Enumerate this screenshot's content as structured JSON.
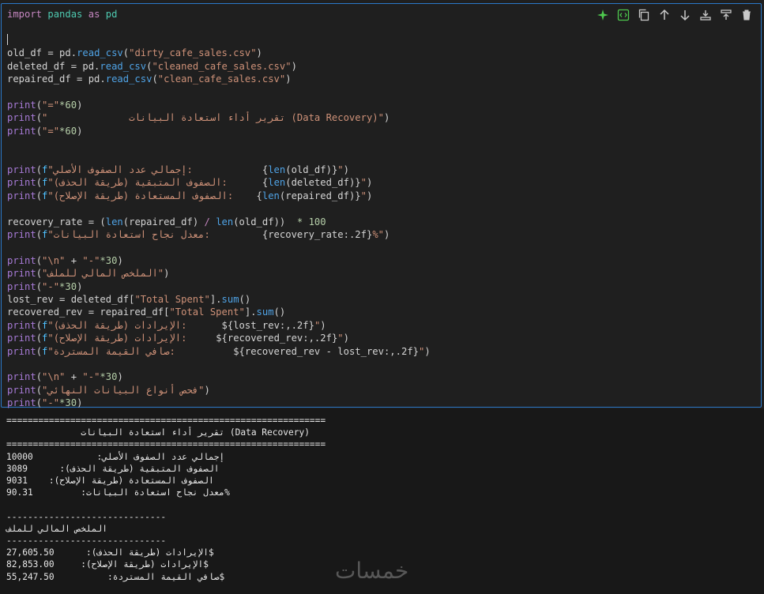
{
  "toolbar": {
    "icons": [
      "sparkle-icon",
      "code-icon",
      "copy-icon",
      "arrow-up-icon",
      "arrow-down-icon",
      "insert-below-icon",
      "insert-above-icon",
      "trash-icon"
    ]
  },
  "code": {
    "l1_import": "import",
    "l1_pandas": " pandas ",
    "l1_as": "as",
    "l1_pd": " pd",
    "l3_a": "old_df = pd.",
    "read_csv": "read_csv",
    "l3_s": "\"dirty_cafe_sales.csv\"",
    "l4_a": "deleted_df = pd.",
    "l4_s": "\"cleaned_cafe_sales.csv\"",
    "l5_a": "repaired_df = pd.",
    "l5_s": "\"clean_cafe_sales.csv\"",
    "print": "print",
    "eq_str": "\"=\"",
    "star60": "*60",
    "title_str": "\"              تقرير أداء استعادة البيانات (Data Recovery)\"",
    "f": "f",
    "l11_s": "\"إجمالي عدد الصفوف الأصلي:            ",
    "len": "len",
    "l11_v": "old_df",
    "l12_s": "\"الصفوف المتبقية (طريقة الحذف):      ",
    "l12_v": "deleted_df",
    "l13_s": "\"الصفوف المستعادة (طريقة الإصلاح):    ",
    "l13_v": "repaired_df",
    "l15_a": "recovery_rate = (",
    "l15_b": " * 100",
    "l16_s": "\"معدل نجاح استعادة البيانات:         ",
    "l16_v": "recovery_rate:.2f",
    "l16_e": "%\"",
    "nl_str": "\"\\n\"",
    "dash_str": "\"-\"",
    "star30": "*30",
    "l19_s": "\"الملخص المالي للملف\"",
    "l21_a": "lost_rev = deleted_df[",
    "ts": "\"Total Spent\"",
    "sum": "sum",
    "l22_a": "recovered_rev = repaired_df[",
    "l23_s": "\"الإيرادات (طريقة الحذف):      ",
    "l23_v": "lost_rev:,.2f",
    "l24_s": "\"الإيرادات (طريقة الإصلاح):     ",
    "l24_v": "recovered_rev:,.2f",
    "l25_s": "\"صافي القيمة المستردة:          ",
    "l25_v": "recovered_rev - lost_rev:,.2f",
    "l28_s": "\"فحص أنواع البيانات النهائي\""
  },
  "output": {
    "o1": "============================================================",
    "o2": "              تقرير أداء استعادة البيانات (Data Recovery)",
    "o3": "============================================================",
    "o4": "إجمالي عدد الصفوف الأصلي:            10000",
    "o5": "الصفوف المتبقية (طريقة الحذف):      3089",
    "o6": "الصفوف المستعادة (طريقة الإصلاح):    9031",
    "o7": "معدل نجاح استعادة البيانات:         90.31%",
    "o8": "",
    "o9": "------------------------------",
    "o10": "الملخص المالي للملف",
    "o11": "------------------------------",
    "o12": "الإيرادات (طريقة الحذف):      27,605.50$",
    "o13": "الإيرادات (طريقة الإصلاح):     82,853.00$",
    "o14": "صافي القيمة المستردة:          55,247.50$"
  },
  "watermark": "خمسات"
}
